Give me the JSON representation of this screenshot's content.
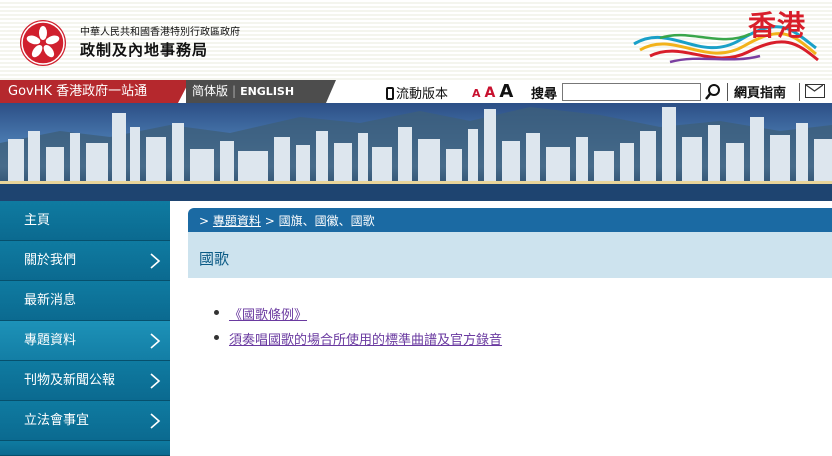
{
  "header": {
    "dept_small": "中華人民共和國香港特別行政區政府",
    "dept_big": "政制及內地事務局",
    "brand_text": "香港"
  },
  "navbar": {
    "govhk": "GovHK 香港政府一站通",
    "simplified": "简体版",
    "english": "ENGLISH",
    "mobile": "流動版本",
    "font_small": "A",
    "font_medium": "A",
    "font_large": "A",
    "search_label": "搜尋",
    "search_placeholder": "",
    "guide": "網頁指南"
  },
  "sidebar": {
    "items": [
      {
        "label": "主頁",
        "chevron": false,
        "active": false
      },
      {
        "label": "關於我們",
        "chevron": true,
        "active": false
      },
      {
        "label": "最新消息",
        "chevron": false,
        "active": false
      },
      {
        "label": "專題資料",
        "chevron": true,
        "active": true
      },
      {
        "label": "刊物及新聞公報",
        "chevron": true,
        "active": false
      },
      {
        "label": "立法會事宜",
        "chevron": true,
        "active": false
      }
    ]
  },
  "breadcrumb": {
    "prefix": ">",
    "link": "專題資料",
    "current": "> 國旗、國徽、國歌"
  },
  "page_title": "國歌",
  "links": [
    "《國歌條例》",
    "須奏唱國歌的場合所使用的標準曲譜及官方錄音"
  ],
  "colors": {
    "govhk_red": "#b5282d",
    "sidebar_blue": "#0b6a90",
    "crumb_blue": "#1b6aa3",
    "title_bg": "#cde3ee",
    "link_purple": "#6a3aa0"
  }
}
